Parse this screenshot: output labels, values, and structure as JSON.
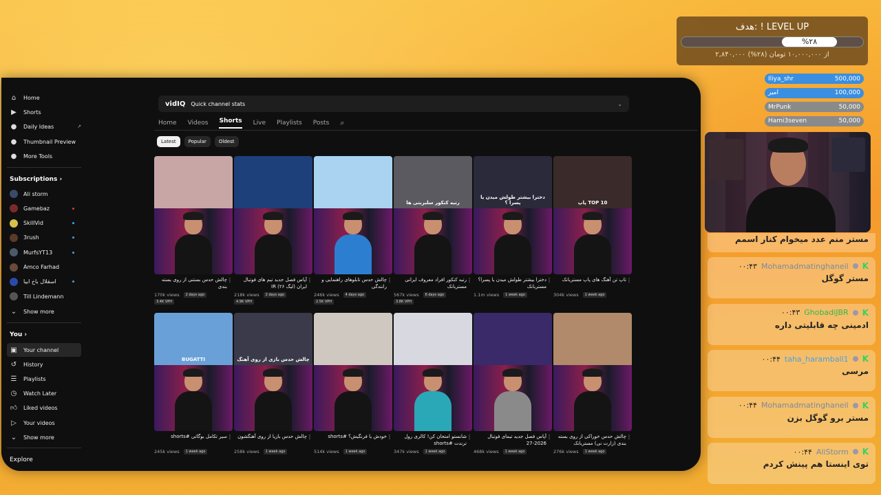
{
  "sidebar": {
    "main": [
      {
        "label": "Home",
        "icon": "home-icon"
      },
      {
        "label": "Shorts",
        "icon": "shorts-icon"
      },
      {
        "label": "Daily Ideas",
        "icon": "bulb-icon"
      },
      {
        "label": "Thumbnail Preview",
        "icon": "image-icon"
      },
      {
        "label": "More Tools",
        "icon": "tools-icon"
      }
    ],
    "subscriptions_title": "Subscriptions",
    "subscriptions": [
      {
        "label": "Ali storm",
        "color": "#3a4a6a"
      },
      {
        "label": "Gamebaz",
        "color": "#7a2a2a"
      },
      {
        "label": "SkillVid",
        "color": "#d6c24a"
      },
      {
        "label": "3rush",
        "color": "#5a3a2a"
      },
      {
        "label": "MurfsYT13",
        "color": "#4a5a6a"
      },
      {
        "label": "Amco Farhad",
        "color": "#6a4a3a"
      },
      {
        "label": "اسقلال باخ ابیا",
        "color": "#2a4aaa"
      },
      {
        "label": "Till Lindemann",
        "color": "#555555"
      }
    ],
    "show_more": "Show more",
    "you_title": "You",
    "you": [
      {
        "label": "Your channel",
        "icon": "channel-icon"
      },
      {
        "label": "History",
        "icon": "history-icon"
      },
      {
        "label": "Playlists",
        "icon": "playlists-icon"
      },
      {
        "label": "Watch Later",
        "icon": "clock-icon"
      },
      {
        "label": "Liked videos",
        "icon": "like-icon"
      },
      {
        "label": "Your videos",
        "icon": "play-icon"
      }
    ],
    "show_more2": "Show more",
    "explore": "Explore"
  },
  "vidiq": {
    "brand": "vidIQ",
    "label": "Quick channel stats"
  },
  "tabs": [
    "Home",
    "Videos",
    "Shorts",
    "Live",
    "Playlists",
    "Posts"
  ],
  "chips": [
    "Latest",
    "Popular",
    "Oldest"
  ],
  "row1": [
    {
      "title": "چالش حدس بستنی از روی بسته بندی",
      "views": "170k views",
      "ago": "2 days ago",
      "vph": "3.4K VPH",
      "overlay": ""
    },
    {
      "title": "آپاس فصل جدید تیم های فوتبال ایران (لیگ ۲۶) IR",
      "views": "218k views",
      "ago": "2 days ago",
      "vph": "4.9K VPH",
      "overlay": ""
    },
    {
      "title": "چالش حدس تابلوهای راهنمایی و رانندگی",
      "views": "246k views",
      "ago": "4 days ago",
      "vph": "2.5K VPH",
      "overlay": ""
    },
    {
      "title": "رتبه کنکور افراد معروف ایرانی مستربانک",
      "views": "567k views",
      "ago": "6 days ago",
      "vph": "3.8K VPH",
      "overlay": "رتبه کنکور سلبریتی ها"
    },
    {
      "title": "دخترا بیشتر طولش میدن یا پسرا؟ مستربانک",
      "views": "1.1m views",
      "ago": "1 week ago",
      "vph": "",
      "overlay": "دخترا بیشتر طولش میدن یا پسرا ؟"
    },
    {
      "title": "تاپ تن آهنگ های پاپ مستربانک",
      "views": "304k views",
      "ago": "1 week ago",
      "vph": "",
      "overlay": "پاپ TOP 10"
    }
  ],
  "row2": [
    {
      "title": "سیر تکامل بوگاتی #shorts",
      "views": "245k views",
      "ago": "1 week ago",
      "overlay": "BUGATTI"
    },
    {
      "title": "چالش حدس بازیا از روی آهنگشون",
      "views": "258k views",
      "ago": "1 week ago",
      "overlay": "چالش حدس بازی از روی آهنگ"
    },
    {
      "title": "خودش یا فرنگیش؟ #shorts",
      "views": "514k views",
      "ago": "1 week ago",
      "overlay": ""
    },
    {
      "title": "شانستو امتحان کن! کالری رول ترندت #shorts",
      "views": "347k views",
      "ago": "1 week ago",
      "overlay": ""
    },
    {
      "title": "آپاس فصل جدید تیمای فوتبال 2026-27",
      "views": "468k views",
      "ago": "1 week ago",
      "overlay": ""
    },
    {
      "title": "چالش حدس خوراکی از روی بسته بندی (زارت نی) مستربانک",
      "views": "276k views",
      "ago": "1 week ago",
      "overlay": ""
    }
  ],
  "goal": {
    "title": "هدف: ! LEVEL UP",
    "percent": "%۲۸",
    "sub": "۲,۸۴۰,۰۰۰ از ۱۰,۰۰۰,۰۰۰ تومان (۲۸%)"
  },
  "donors": [
    {
      "name": "Iliya_shr",
      "amount": "500,000",
      "color": "#3a8fe0"
    },
    {
      "name": "امیر",
      "amount": "100,000",
      "color": "#3a8fe0"
    },
    {
      "name": "MrPunk",
      "amount": "50,000",
      "color": "#8a8a8a"
    },
    {
      "name": "Hami3seven",
      "amount": "50,000",
      "color": "#8a8a8a"
    }
  ],
  "chat_top": "مستر منم عدد میخوام کنار اسمم",
  "chat": [
    {
      "user": "Mohamadmatinghaneil",
      "time": "۰۰:۴۳",
      "text": "مستر گوگل",
      "ucolor": "#7a8aa0"
    },
    {
      "user": "GhobadiJBR",
      "time": "۰۰:۴۳",
      "text": "ادمینی چه قابلیتی داره",
      "ucolor": "#2fb94a"
    },
    {
      "user": "taha_haramball1",
      "time": "۰۰:۴۴",
      "text": "مرسی",
      "ucolor": "#4aa0e0"
    },
    {
      "user": "Mohamadmatinghaneil",
      "time": "۰۰:۴۴",
      "text": "مستر برو گوگل بزن",
      "ucolor": "#7a8aa0"
    },
    {
      "user": "AliStorm",
      "time": "۰۰:۴۴",
      "text": "توی اینستا هم پینش کردم",
      "ucolor": "#7a8aa0"
    }
  ]
}
